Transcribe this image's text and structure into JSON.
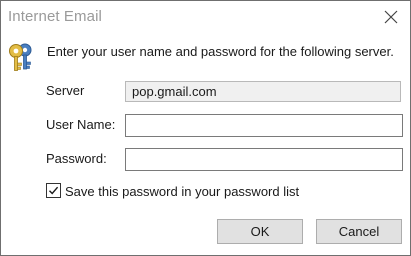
{
  "dialog": {
    "title": "Internet Email",
    "prompt": "Enter your user name and password for the following server.",
    "icons": {
      "close": "close-icon",
      "keys": "keys-icon",
      "check": "checkmark-icon"
    }
  },
  "form": {
    "server_label": "Server",
    "server_value": "pop.gmail.com",
    "username_label": "User Name:",
    "username_value": "",
    "password_label": "Password:",
    "password_value": "",
    "save_password_label": "Save this password in your password list",
    "save_password_checked": true
  },
  "buttons": {
    "ok_label": "OK",
    "cancel_label": "Cancel"
  },
  "colors": {
    "title_text": "#9a9a9a",
    "server_field_bg": "#f0f0f0",
    "button_bg": "#e1e1e1",
    "key_gold": "#d9b23a",
    "key_blue": "#4a7fc1"
  }
}
